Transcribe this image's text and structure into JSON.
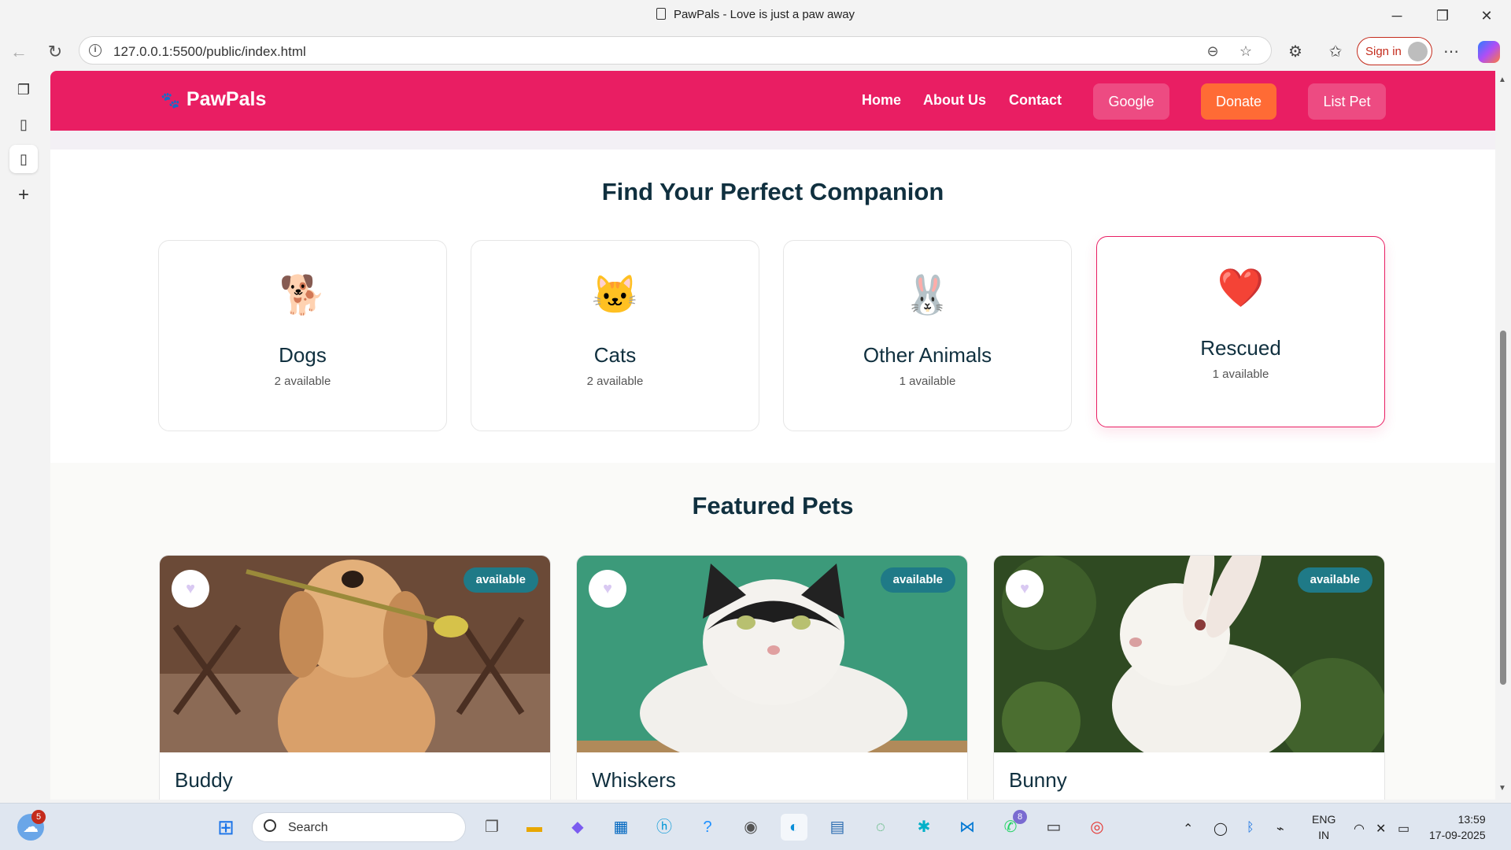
{
  "window": {
    "title": "PawPals - Love is just a paw away",
    "url": "127.0.0.1:5500/public/index.html",
    "sign_in": "Sign in"
  },
  "site": {
    "brand": "PawPals",
    "nav": {
      "home": "Home",
      "about": "About Us",
      "contact": "Contact",
      "google": "Google",
      "donate": "Donate",
      "list_pet": "List Pet"
    },
    "colors": {
      "primary": "#e91e63",
      "donate": "#ff6b35",
      "badge": "#1f7a87"
    }
  },
  "categories": {
    "title": "Find Your Perfect Companion",
    "items": [
      {
        "emoji": "🐕",
        "name": "Dogs",
        "count": "2 available"
      },
      {
        "emoji": "🐱",
        "name": "Cats",
        "count": "2 available"
      },
      {
        "emoji": "🐰",
        "name": "Other Animals",
        "count": "1 available"
      },
      {
        "emoji": "❤️",
        "name": "Rescued",
        "count": "1 available"
      }
    ]
  },
  "featured": {
    "title": "Featured Pets",
    "pets": [
      {
        "name": "Buddy",
        "status": "available",
        "fav_icon": "heart-icon"
      },
      {
        "name": "Whiskers",
        "status": "available",
        "fav_icon": "heart-icon"
      },
      {
        "name": "Bunny",
        "status": "available",
        "fav_icon": "heart-icon"
      }
    ]
  },
  "taskbar": {
    "search": "Search",
    "weather_badge": "5",
    "whatsapp_badge": "8",
    "lang": "ENG",
    "region": "IN",
    "time": "13:59",
    "date": "17-09-2025"
  }
}
